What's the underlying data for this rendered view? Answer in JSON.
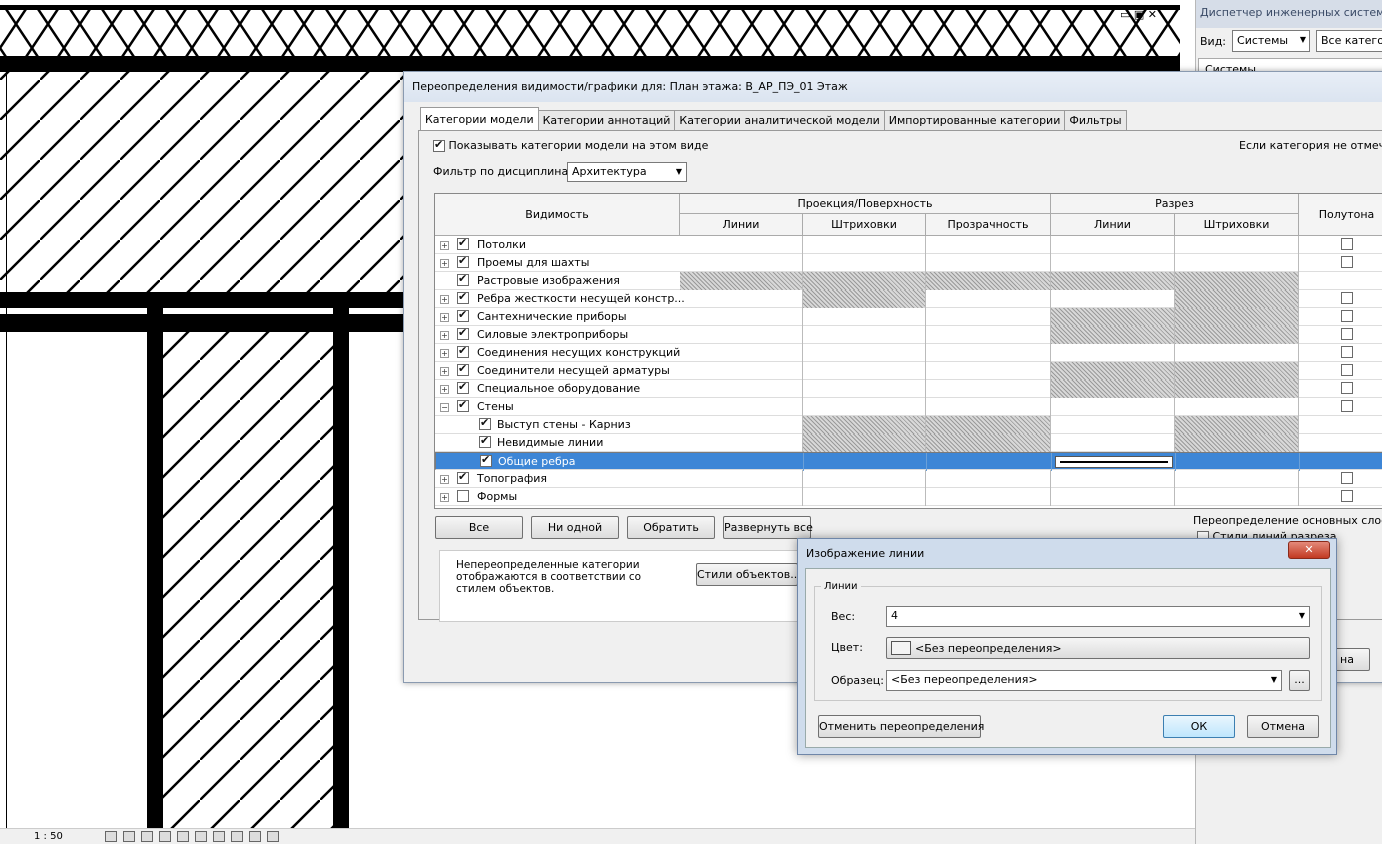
{
  "canvas": {
    "controls": "▭ ▣ ✕",
    "scale": "1 : 50"
  },
  "right_panel": {
    "title": "Диспетчер инженерных систем - А",
    "view_label": "Вид:",
    "view_value": "Системы",
    "filter_value": "Все катего",
    "tree_item": "Системы"
  },
  "dialog": {
    "title": "Переопределения видимости/графики для: План этажа: В_АР_ПЭ_01 Этаж",
    "tabs": [
      "Категории модели",
      "Категории аннотаций",
      "Категории аналитической модели",
      "Импортированные категории",
      "Фильтры"
    ],
    "show_categories": "Показывать категории модели на этом виде",
    "not_checked_note": "Если категория не отмечена",
    "discipline_label": "Фильтр по дисциплинам:",
    "discipline_value": "Архитектура",
    "headers": {
      "visibility": "Видимость",
      "projection": "Проекция/Поверхность",
      "cut": "Разрез",
      "lines": "Линии",
      "hatch": "Штриховки",
      "transparency": "Прозрачность",
      "halftone": "Полутона"
    },
    "rows": [
      {
        "label": "Потолки",
        "level": 0,
        "expand": "+",
        "checked": true
      },
      {
        "label": "Проемы для шахты",
        "level": 0,
        "expand": "+",
        "checked": true
      },
      {
        "label": "Растровые изображения",
        "level": 0,
        "expand": "",
        "checked": true
      },
      {
        "label": "Ребра жесткости несущей констр...",
        "level": 0,
        "expand": "+",
        "checked": true
      },
      {
        "label": "Сантехнические приборы",
        "level": 0,
        "expand": "+",
        "checked": true
      },
      {
        "label": "Силовые электроприборы",
        "level": 0,
        "expand": "+",
        "checked": true
      },
      {
        "label": "Соединения несущих конструкций",
        "level": 0,
        "expand": "+",
        "checked": true
      },
      {
        "label": "Соединители несущей арматуры",
        "level": 0,
        "expand": "+",
        "checked": true
      },
      {
        "label": "Специальное оборудование",
        "level": 0,
        "expand": "+",
        "checked": true
      },
      {
        "label": "Стены",
        "level": 0,
        "expand": "−",
        "checked": true
      },
      {
        "label": "Выступ стены - Карниз",
        "level": 1,
        "expand": "",
        "checked": true
      },
      {
        "label": "Невидимые линии",
        "level": 1,
        "expand": "",
        "checked": true
      },
      {
        "label": "Общие ребра",
        "level": 1,
        "expand": "",
        "checked": true
      },
      {
        "label": "Топография",
        "level": 0,
        "expand": "+",
        "checked": true
      },
      {
        "label": "Формы",
        "level": 0,
        "expand": "+",
        "checked": false
      }
    ],
    "buttons": {
      "all": "Все",
      "none": "Ни одной",
      "invert": "Обратить",
      "expand_all": "Развернуть все",
      "object_styles": "Стили объектов..."
    },
    "note": "Непереопределенные категории отображаются в соответствии со стилем объектов.",
    "override_layers": "Переопределение основных слоев",
    "cut_line_styles": "Стили линий разреза",
    "cancel_partial": "на"
  },
  "line_dialog": {
    "title": "Изображение линии",
    "close": "✕",
    "group": "Линии",
    "weight_label": "Вес:",
    "weight_value": "4",
    "color_label": "Цвет:",
    "color_value": "<Без переопределения>",
    "pattern_label": "Образец:",
    "pattern_value": "<Без переопределения>",
    "more": "...",
    "reset": "Отменить переопределения",
    "ok": "ОК",
    "cancel": "Отмена"
  }
}
